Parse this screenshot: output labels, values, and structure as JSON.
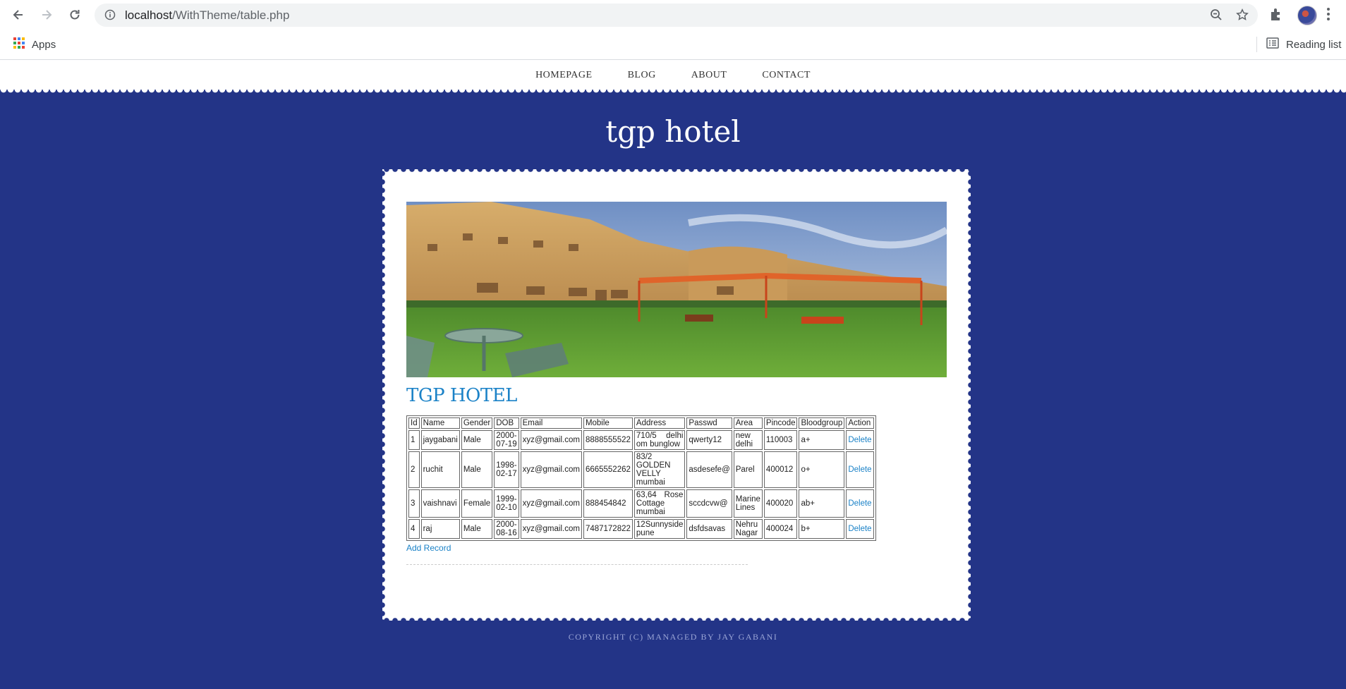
{
  "browser": {
    "url_host": "localhost",
    "url_path": "/WithTheme/table.php",
    "bookmarks": {
      "apps_label": "Apps",
      "reading_list_label": "Reading list"
    }
  },
  "site": {
    "nav": [
      "HOMEPAGE",
      "BLOG",
      "ABOUT",
      "CONTACT"
    ],
    "title": "tgp hotel",
    "heading": "TGP HOTEL",
    "add_record_label": "Add Record",
    "footer": "COPYRIGHT (C) MANAGED BY JAY GABANI"
  },
  "table": {
    "headers": [
      "Id",
      "Name",
      "Gender",
      "DOB",
      "Email",
      "Mobile",
      "Address",
      "Passwd",
      "Area",
      "Pincode",
      "Bloodgroup",
      "Action"
    ],
    "rows": [
      {
        "id": "1",
        "name": "jaygabani",
        "gender": "Male",
        "dob": "2000-07-19",
        "email": "xyz@gmail.com",
        "mobile": "8888555522",
        "address": "710/5 delhi om bunglow",
        "passwd": "qwerty12",
        "area": "new delhi",
        "pincode": "110003",
        "bloodgroup": "a+",
        "action": "Delete"
      },
      {
        "id": "2",
        "name": "ruchit",
        "gender": "Male",
        "dob": "1998-02-17",
        "email": "xyz@gmail.com",
        "mobile": "6665552262",
        "address": "83/2 GOLDEN VELLY mumbai",
        "passwd": "asdesefe@",
        "area": "Parel",
        "pincode": "400012",
        "bloodgroup": "o+",
        "action": "Delete"
      },
      {
        "id": "3",
        "name": "vaishnavi",
        "gender": "Female",
        "dob": "1999-02-10",
        "email": "xyz@gmail.com",
        "mobile": "888454842",
        "address": "63,64 Rose Cottage mumbai",
        "passwd": "sccdcvw@",
        "area": "Marine Lines",
        "pincode": "400020",
        "bloodgroup": "ab+",
        "action": "Delete"
      },
      {
        "id": "4",
        "name": "raj",
        "gender": "Male",
        "dob": "2000-08-16",
        "email": "xyz@gmail.com",
        "mobile": "7487172822",
        "address": "12Sunnyside pune",
        "passwd": "dsfdsavas",
        "area": "Nehru Nagar",
        "pincode": "400024",
        "bloodgroup": "b+",
        "action": "Delete"
      }
    ]
  },
  "colors": {
    "page_bg": "#233487",
    "link": "#1b82c7",
    "heading": "#1b82c7"
  },
  "icons": [
    "back-icon",
    "forward-icon",
    "reload-icon",
    "info-icon",
    "zoom-icon",
    "star-icon",
    "extensions-icon",
    "profile-avatar",
    "more-menu-icon",
    "apps-grid-icon",
    "reading-list-icon"
  ]
}
